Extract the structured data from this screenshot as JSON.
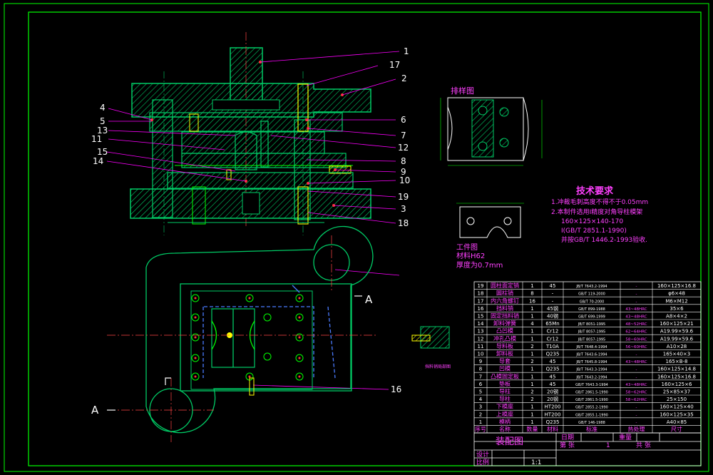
{
  "colors": {
    "background": "#000000",
    "frame": "#00ff00",
    "part": "#00cc66",
    "hatch": "#00cc66",
    "leader": "#ff00ff",
    "text_magenta": "#ff40ff",
    "text_white": "#ffffff",
    "bolt_yellow": "#ffff00",
    "dim_blue": "#4a7bff",
    "bolt_red": "#ff3333"
  },
  "balloons": {
    "b1": "1",
    "b17": "17",
    "b2": "2",
    "b4": "4",
    "b5": "5",
    "b13": "13",
    "b11": "11",
    "b15": "15",
    "b14": "14",
    "b6": "6",
    "b7": "7",
    "b12": "12",
    "b8": "8",
    "b9": "9",
    "b10": "10",
    "b19": "19",
    "b3": "3",
    "b18": "18",
    "b16": "16"
  },
  "section_labels": {
    "left": "A",
    "right": "A"
  },
  "strip_layout": {
    "title": "排样图"
  },
  "workpiece": {
    "title": "工件图",
    "material": "材料H62",
    "thickness": "厚度为0.7mm"
  },
  "tech": {
    "title": "技术要求",
    "l1": "1.冲裁毛刺高度不得不于0.05mm",
    "l2": "2.本制件选用Ⅰ精度对角导柱模架",
    "l3": "160×125×140-170",
    "l4": "Ⅰ(GB/T 2851.1-1990)",
    "l5": "并按GB/T 1446.2-1993验收."
  },
  "bom_rows": [
    [
      "19",
      "圆柱面定销",
      "1",
      "45",
      "JB/T 7643.2-1994",
      "-",
      "160×125×16.8"
    ],
    [
      "18",
      "圆柱销",
      "8",
      "-",
      "GB/T 119-2000",
      "-",
      "φ6×48"
    ],
    [
      "17",
      "内六角螺钉",
      "16",
      "-",
      "GB/T 70-2000",
      "-",
      "M6×M12"
    ],
    [
      "16",
      "挡料销",
      "1",
      "45钢",
      "GB/T 899-1988",
      "43~48HRC",
      "35×6"
    ],
    [
      "15",
      "固定挡料销",
      "1",
      "40钢",
      "GB/T 699-1999",
      "43~48HRC",
      "A8×4×2"
    ],
    [
      "14",
      "卸料弹簧",
      "4",
      "65Mn",
      "JB/T 8051-1995",
      "48~52HRC",
      "160×125×21"
    ],
    [
      "13",
      "凸凹模",
      "1",
      "Cr12",
      "JB/T 8057-1995",
      "62~64HRC",
      "A19.99×59.6"
    ],
    [
      "12",
      "冲孔凸模",
      "1",
      "Cr12",
      "JB/T 8057-1995",
      "58~60HRC",
      "A19.99×59.6"
    ],
    [
      "11",
      "导料板",
      "2",
      "T10A",
      "JB/T 7648.4-1994",
      "56~60HRC",
      "A10×28"
    ],
    [
      "10",
      "卸料板",
      "1",
      "Q235",
      "JB/T 7643.6-1994",
      "-",
      "165×40×3"
    ],
    [
      "9",
      "导套",
      "2",
      "45",
      "JB/T 7645.8-1994",
      "43~48HRC",
      "165×B-8"
    ],
    [
      "8",
      "凹模",
      "1",
      "Q235",
      "JB/T 7643.3-1994",
      "-",
      "160×125×14.8"
    ],
    [
      "7",
      "凸模固定板",
      "1",
      "45",
      "JB/T 7643.2-1994",
      "-",
      "160×125×16.8"
    ],
    [
      "6",
      "垫板",
      "1",
      "45",
      "GB/T 7643.3-1994",
      "43~48HRC",
      "160×125×6"
    ],
    [
      "5",
      "导柱",
      "2",
      "20钢",
      "GB/T 2861.5-1990",
      "58~62HRC",
      "25×85×37"
    ],
    [
      "4",
      "导柱",
      "2",
      "20钢",
      "GB/T 2861.5-1990",
      "58~62HRC",
      "25×150"
    ],
    [
      "3",
      "下模座",
      "1",
      "HT200",
      "GB/T 2855.2-1990",
      "-",
      "160×125×40"
    ],
    [
      "2",
      "上模座",
      "1",
      "HT200",
      "GB/T 2855.1-1990",
      "-",
      "160×125×35"
    ],
    [
      "1",
      "模柄",
      "1",
      "Q235",
      "GB/T 146-1988",
      "-",
      "A40×85"
    ]
  ],
  "bom_header": [
    "序号",
    "名称",
    "数量",
    "材料",
    "标准",
    "热处理",
    "尺寸"
  ],
  "title_block": {
    "name": "装配图",
    "date_label": "日期",
    "sheet_label": "第 张",
    "count": "1",
    "page_label": "共 张",
    "designer": "设计",
    "scale_label": "比例",
    "scale": "1:1",
    "weight_label": "重量"
  }
}
